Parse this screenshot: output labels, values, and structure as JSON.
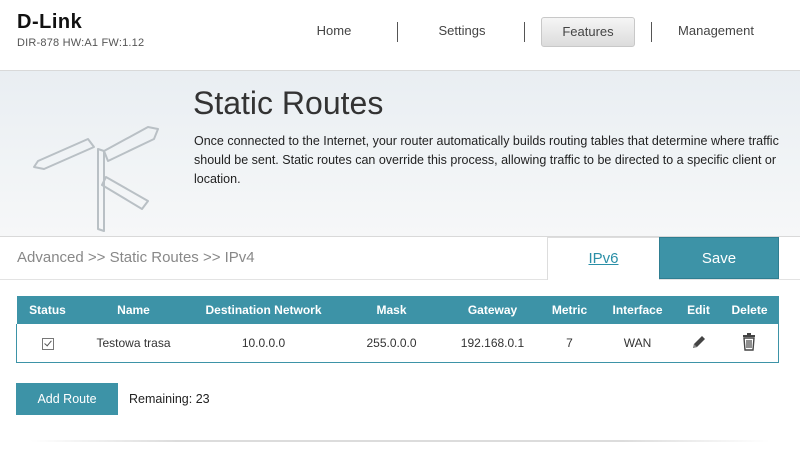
{
  "header": {
    "brand": "D-Link",
    "model_info": "DIR-878 HW:A1 FW:1.12",
    "nav": [
      {
        "label": "Home",
        "active": false
      },
      {
        "label": "Settings",
        "active": false
      },
      {
        "label": "Features",
        "active": true
      },
      {
        "label": "Management",
        "active": false
      }
    ]
  },
  "hero": {
    "title": "Static Routes",
    "description": "Once connected to the Internet, your router automatically builds routing tables that determine where traffic should be sent. Static routes can override this process, allowing traffic to be directed to a specific client or location.",
    "illustration": "signpost-icon"
  },
  "breadcrumb": "Advanced >> Static Routes >> IPv4",
  "tabs": {
    "ipv6_label": "IPv6",
    "save_label": "Save"
  },
  "table": {
    "columns": [
      "Status",
      "Name",
      "Destination Network",
      "Mask",
      "Gateway",
      "Metric",
      "Interface",
      "Edit",
      "Delete"
    ],
    "rows": [
      {
        "status": true,
        "name": "Testowa trasa",
        "destination": "10.0.0.0",
        "mask": "255.0.0.0",
        "gateway": "192.168.0.1",
        "metric": "7",
        "interface": "WAN",
        "edit_icon": "pencil-icon",
        "delete_icon": "trash-icon"
      }
    ]
  },
  "footer": {
    "add_route_label": "Add Route",
    "remaining_label": "Remaining: 23"
  },
  "colors": {
    "accent": "#3d93a7",
    "link": "#2a8fa7"
  }
}
